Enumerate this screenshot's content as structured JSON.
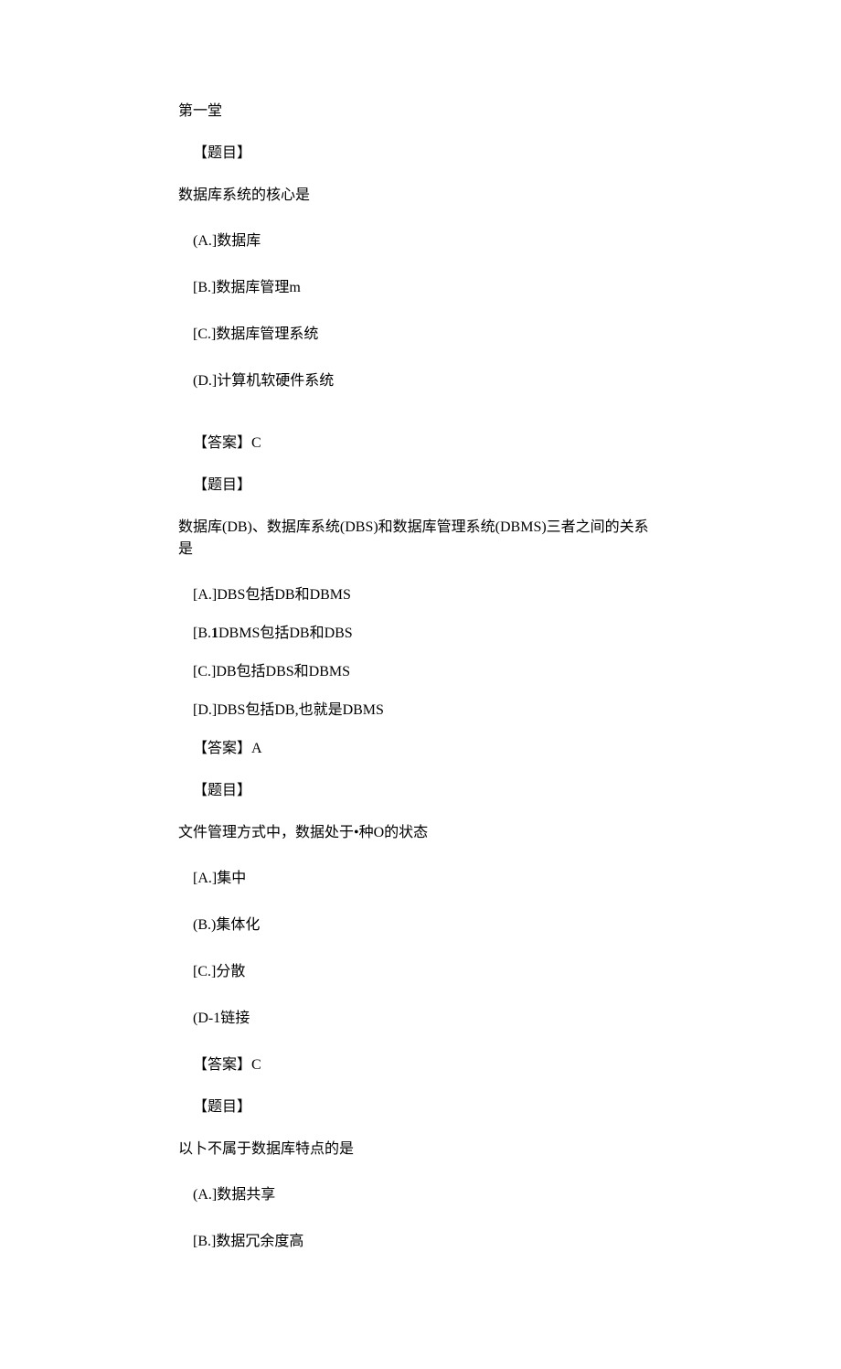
{
  "header": "第一堂",
  "labels": {
    "question": "【题目】",
    "answer": "【答案】"
  },
  "questions": [
    {
      "stem": "数据库系统的核心是",
      "options": [
        "(A.]数据库",
        "[B.]数据库管理m",
        "[C.]数据库管理系统",
        "(D.]计算机软硬件系统"
      ],
      "answer": "C"
    },
    {
      "stem": "数据库(DB)、数据库系统(DBS)和数据库管理系统(DBMS)三者之间的关系是",
      "options": [
        "[A.]DBS包括DB和DBMS",
        "[B.1DBMS包括DB和DBS",
        "[C.]DB包括DBS和DBMS",
        "[D.]DBS包括DB,也就是DBMS"
      ],
      "answer": "A",
      "bold_idx": 1,
      "bold_prefix": "[B.",
      "bold_char": "1",
      "bold_suffix": "DBMS包括DB和DBS"
    },
    {
      "stem": "文件管理方式中，数据处于•种O的状态",
      "options": [
        "[A.]集中",
        "(B.)集体化",
        "[C.]分散",
        "(D-1链接"
      ],
      "answer": "C"
    },
    {
      "stem": "以卜不属于数据库特点的是",
      "options": [
        "(A.]数据共享",
        "[B.]数据冗余度高"
      ],
      "answer": ""
    }
  ]
}
